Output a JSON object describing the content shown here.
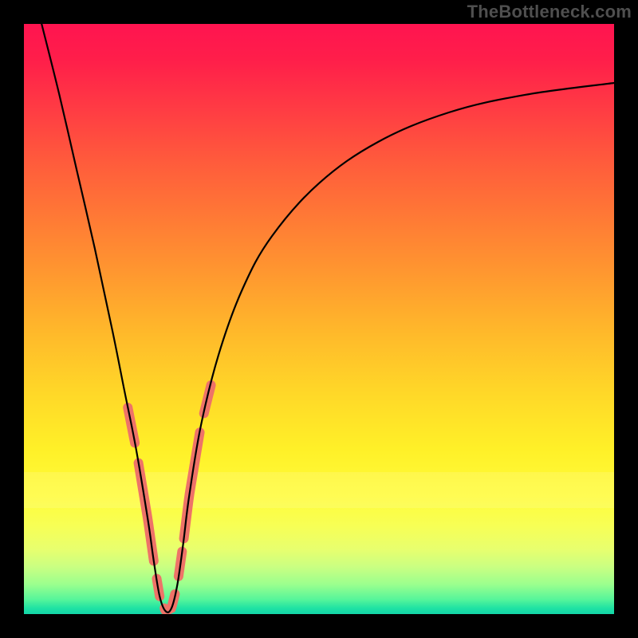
{
  "watermark": "TheBottleneck.com",
  "colors": {
    "background_frame": "#000000",
    "watermark_text": "#4f4f4f",
    "curve": "#000000",
    "highlight_segments": "#ee7368",
    "gradient_top": "#ff1450",
    "gradient_bottom": "#13d6a8"
  },
  "chart_data": {
    "type": "line",
    "title": "",
    "xlabel": "",
    "ylabel": "",
    "xlim": [
      0,
      100
    ],
    "ylim": [
      0,
      100
    ],
    "note": "Axis values are estimated from image coordinates (percent of plot area). Low y = bottom (green), high y = top (red). The curve is a deep V-shape with minimum near x≈24.",
    "series": [
      {
        "name": "bottleneck_curve",
        "x": [
          3,
          6,
          9,
          12,
          15,
          17,
          19,
          21,
          22,
          23,
          24,
          25,
          26,
          27,
          28,
          30,
          33,
          37,
          42,
          50,
          60,
          72,
          85,
          100
        ],
        "y": [
          100,
          88,
          75,
          62,
          48,
          38,
          28,
          16,
          9,
          3,
          0.5,
          1,
          5,
          12,
          20,
          32,
          44,
          55,
          64,
          73,
          80,
          85,
          88,
          90
        ]
      }
    ],
    "highlighted_x_ranges": [
      [
        17.6,
        18.8
      ],
      [
        19.4,
        22.0
      ],
      [
        22.5,
        23.0
      ],
      [
        23.8,
        25.6
      ],
      [
        26.2,
        26.8
      ],
      [
        27.1,
        29.8
      ],
      [
        30.5,
        31.7
      ]
    ],
    "yellow_band_y": [
      18,
      24
    ],
    "gradient_stops_y_to_color": [
      [
        100,
        "#ff1450"
      ],
      [
        80,
        "#ff7a35"
      ],
      [
        60,
        "#ffbb2a"
      ],
      [
        40,
        "#fff028"
      ],
      [
        20,
        "#e8ff6e"
      ],
      [
        5,
        "#57f59a"
      ],
      [
        0,
        "#13d6a8"
      ]
    ]
  }
}
